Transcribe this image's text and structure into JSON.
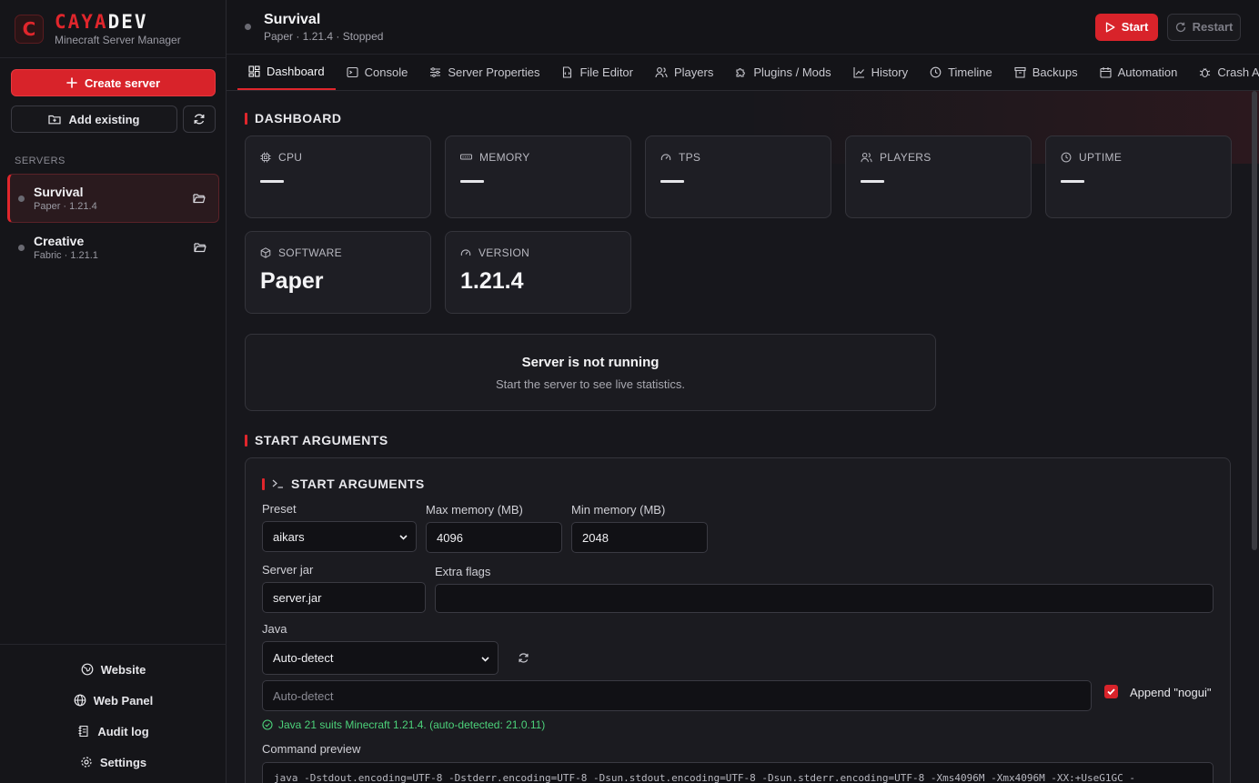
{
  "brand": {
    "logo_letter": "C",
    "name_red": "CAYA",
    "name_white": "DEV",
    "subtitle": "Minecraft Server Manager"
  },
  "sidebar": {
    "create_label": "Create server",
    "add_label": "Add existing",
    "servers_heading": "SERVERS",
    "servers": [
      {
        "name": "Survival",
        "sub": "Paper · 1.21.4"
      },
      {
        "name": "Creative",
        "sub": "Fabric · 1.21.1"
      }
    ],
    "links": [
      {
        "label": "Website",
        "icon": "globe-alt-icon"
      },
      {
        "label": "Web Panel",
        "icon": "globe-icon"
      },
      {
        "label": "Audit log",
        "icon": "log-icon"
      },
      {
        "label": "Settings",
        "icon": "gear-icon"
      }
    ]
  },
  "header": {
    "title": "Survival",
    "subtitle": "Paper · 1.21.4 · Stopped",
    "start_label": "Start",
    "restart_label": "Restart"
  },
  "tabs": [
    {
      "label": "Dashboard",
      "icon": "dashboard-icon"
    },
    {
      "label": "Console",
      "icon": "terminal-icon"
    },
    {
      "label": "Server Properties",
      "icon": "sliders-icon"
    },
    {
      "label": "File Editor",
      "icon": "file-code-icon"
    },
    {
      "label": "Players",
      "icon": "users-icon"
    },
    {
      "label": "Plugins / Mods",
      "icon": "puzzle-icon"
    },
    {
      "label": "History",
      "icon": "chart-icon"
    },
    {
      "label": "Timeline",
      "icon": "clock-icon"
    },
    {
      "label": "Backups",
      "icon": "archive-icon"
    },
    {
      "label": "Automation",
      "icon": "calendar-icon"
    },
    {
      "label": "Crash Ana",
      "icon": "bug-icon"
    }
  ],
  "dashboard": {
    "section_title": "DASHBOARD",
    "stats": [
      {
        "label": "CPU",
        "icon": "cpu-icon"
      },
      {
        "label": "MEMORY",
        "icon": "memory-icon"
      },
      {
        "label": "TPS",
        "icon": "gauge-icon"
      },
      {
        "label": "PLAYERS",
        "icon": "users-icon"
      },
      {
        "label": "UPTIME",
        "icon": "clock-icon"
      }
    ],
    "info": [
      {
        "label": "SOFTWARE",
        "value": "Paper",
        "icon": "box-icon"
      },
      {
        "label": "VERSION",
        "value": "1.21.4",
        "icon": "gauge-icon"
      }
    ],
    "not_running_title": "Server is not running",
    "not_running_sub": "Start the server to see live statistics."
  },
  "start_args": {
    "section_title": "START ARGUMENTS",
    "card_title": "START ARGUMENTS",
    "preset_label": "Preset",
    "preset_value": "aikars",
    "max_mem_label": "Max memory (MB)",
    "max_mem_value": "4096",
    "min_mem_label": "Min memory (MB)",
    "min_mem_value": "2048",
    "jar_label": "Server jar",
    "jar_value": "server.jar",
    "extra_label": "Extra flags",
    "extra_value": "",
    "java_label": "Java",
    "java_value": "Auto-detect",
    "java_path_placeholder": "Auto-detect",
    "nogui_label": "Append \"nogui\"",
    "nogui_checked": true,
    "java_status": "Java 21 suits Minecraft 1.21.4. (auto-detected: 21.0.11)",
    "cmd_label": "Command preview",
    "cmd_value": "java -Dstdout.encoding=UTF-8 -Dstderr.encoding=UTF-8 -Dsun.stdout.encoding=UTF-8 -Dsun.stderr.encoding=UTF-8 -Xms4096M -Xmx4096M -XX:+UseG1GC -"
  },
  "colors": {
    "accent": "#e0262c",
    "bg": "#17171c",
    "card": "#1e1e24",
    "ok": "#4cd27a"
  }
}
